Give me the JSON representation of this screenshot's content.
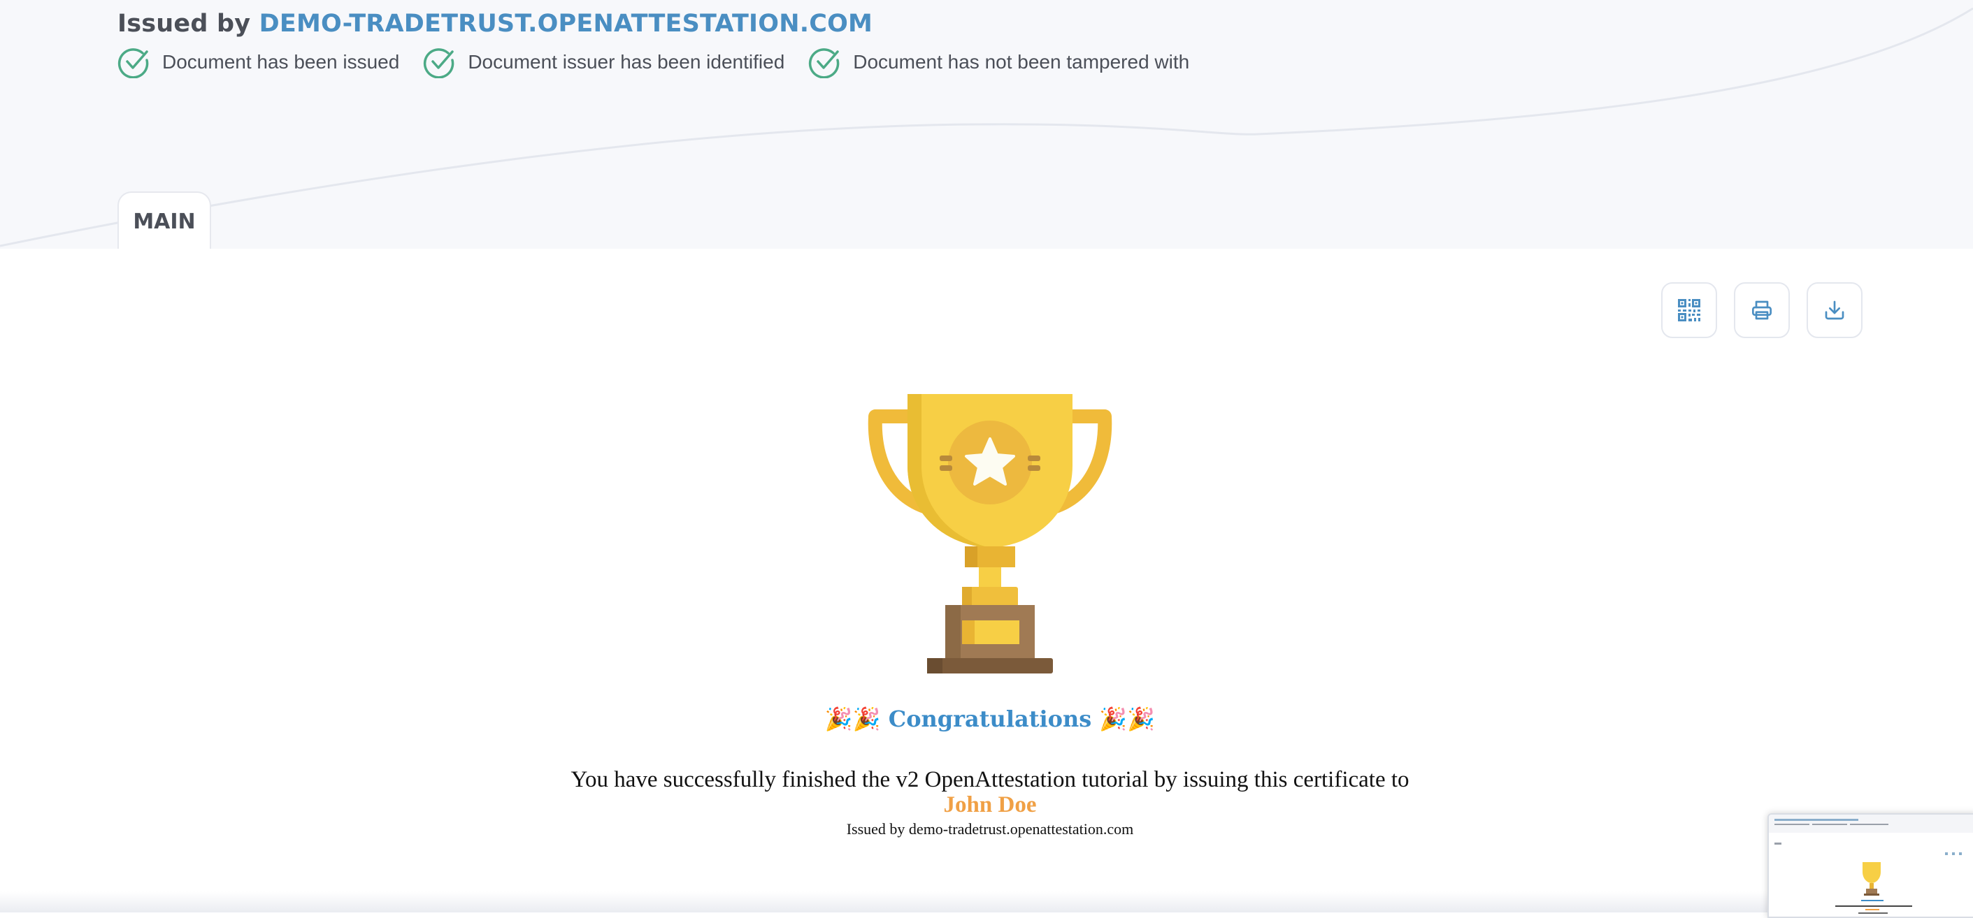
{
  "header": {
    "issued_by_label": "Issued by",
    "issuer_domain": "DEMO-TRADETRUST.OPENATTESTATION.COM",
    "checks": [
      {
        "label": "Document has been issued",
        "icon": "check-circle-icon"
      },
      {
        "label": "Document issuer has been identified",
        "icon": "check-circle-icon"
      },
      {
        "label": "Document has not been tampered with",
        "icon": "check-circle-icon"
      }
    ]
  },
  "tabs": [
    {
      "label": "MAIN",
      "active": true
    }
  ],
  "toolbar": {
    "buttons": [
      {
        "icon": "qr-code-icon"
      },
      {
        "icon": "print-icon"
      },
      {
        "icon": "download-icon"
      }
    ]
  },
  "certificate": {
    "congrats_prefix_emoji": "🎉🎉",
    "congrats_title": "Congratulations",
    "congrats_suffix_emoji": "🎉🎉",
    "message": "You have successfully finished the v2 OpenAttestation tutorial by issuing this certificate to",
    "recipient_name": "John Doe",
    "issuer_line": "Issued by demo-tradetrust.openattestation.com"
  },
  "colors": {
    "accent": "#4a8ec2",
    "check_green": "#4caa86",
    "recipient": "#f0a045",
    "congrats": "#3c8cc8",
    "trophy_gold": "#f7cf45"
  }
}
